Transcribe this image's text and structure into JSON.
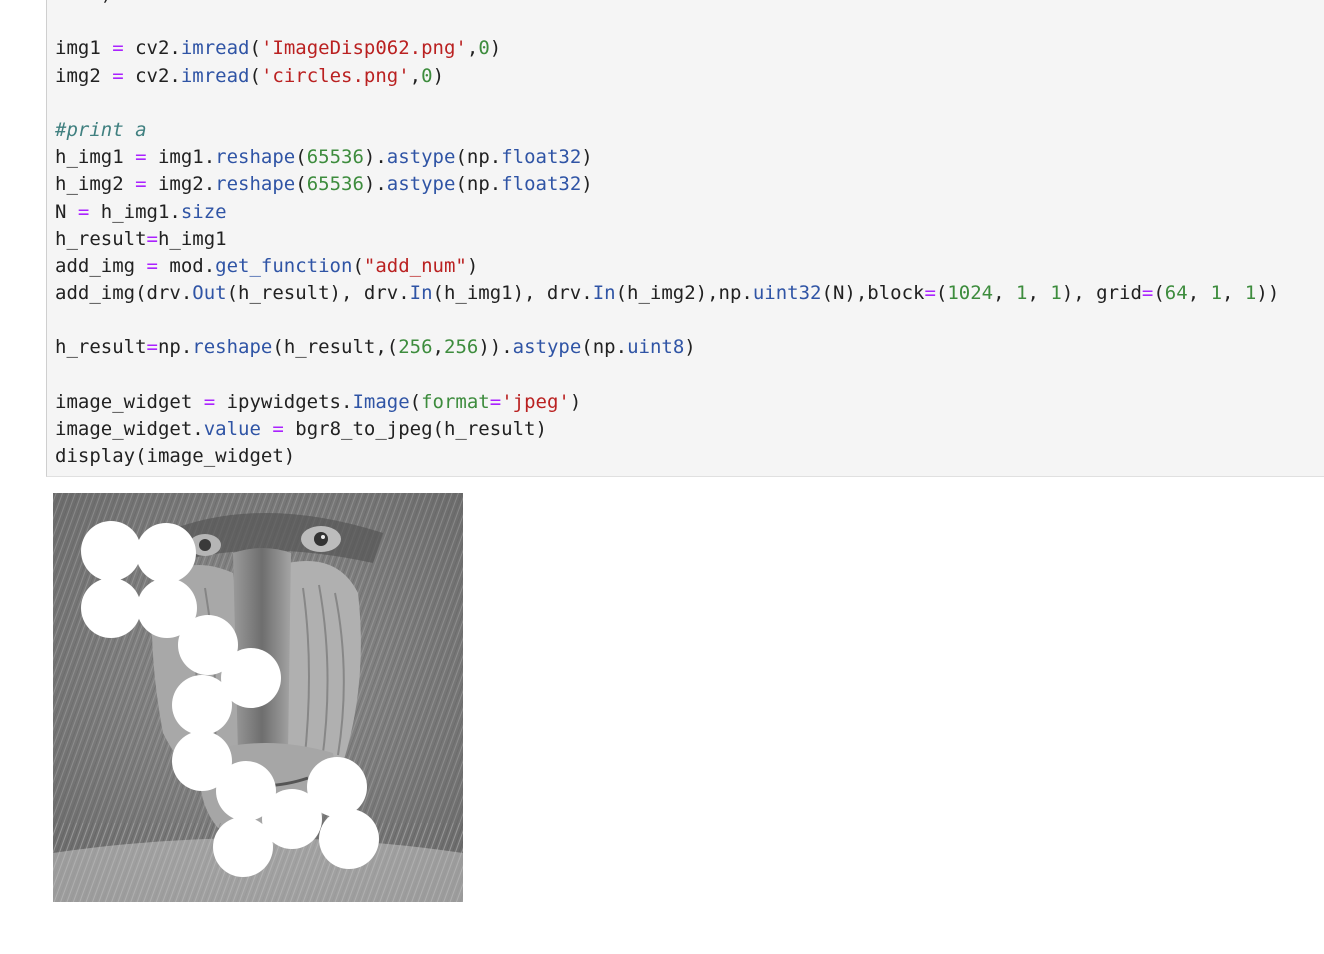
{
  "code_cell": {
    "lines": [
      [
        {
          "t": "    )",
          "c": "plain"
        }
      ],
      [],
      [
        {
          "t": "img1 ",
          "c": "plain"
        },
        {
          "t": "=",
          "c": "op"
        },
        {
          "t": " cv2.",
          "c": "plain"
        },
        {
          "t": "imread",
          "c": "fn"
        },
        {
          "t": "(",
          "c": "plain"
        },
        {
          "t": "'ImageDisp062.png'",
          "c": "str"
        },
        {
          "t": ",",
          "c": "plain"
        },
        {
          "t": "0",
          "c": "num"
        },
        {
          "t": ")",
          "c": "plain"
        }
      ],
      [
        {
          "t": "img2 ",
          "c": "plain"
        },
        {
          "t": "=",
          "c": "op"
        },
        {
          "t": " cv2.",
          "c": "plain"
        },
        {
          "t": "imread",
          "c": "fn"
        },
        {
          "t": "(",
          "c": "plain"
        },
        {
          "t": "'circles.png'",
          "c": "str"
        },
        {
          "t": ",",
          "c": "plain"
        },
        {
          "t": "0",
          "c": "num"
        },
        {
          "t": ")",
          "c": "plain"
        }
      ],
      [],
      [
        {
          "t": "#print a",
          "c": "cm"
        }
      ],
      [
        {
          "t": "h_img1 ",
          "c": "plain"
        },
        {
          "t": "=",
          "c": "op"
        },
        {
          "t": " img1.",
          "c": "plain"
        },
        {
          "t": "reshape",
          "c": "fn"
        },
        {
          "t": "(",
          "c": "plain"
        },
        {
          "t": "65536",
          "c": "num"
        },
        {
          "t": ").",
          "c": "plain"
        },
        {
          "t": "astype",
          "c": "fn"
        },
        {
          "t": "(np.",
          "c": "plain"
        },
        {
          "t": "float32",
          "c": "fn"
        },
        {
          "t": ")",
          "c": "plain"
        }
      ],
      [
        {
          "t": "h_img2 ",
          "c": "plain"
        },
        {
          "t": "=",
          "c": "op"
        },
        {
          "t": " img2.",
          "c": "plain"
        },
        {
          "t": "reshape",
          "c": "fn"
        },
        {
          "t": "(",
          "c": "plain"
        },
        {
          "t": "65536",
          "c": "num"
        },
        {
          "t": ").",
          "c": "plain"
        },
        {
          "t": "astype",
          "c": "fn"
        },
        {
          "t": "(np.",
          "c": "plain"
        },
        {
          "t": "float32",
          "c": "fn"
        },
        {
          "t": ")",
          "c": "plain"
        }
      ],
      [
        {
          "t": "N ",
          "c": "plain"
        },
        {
          "t": "=",
          "c": "op"
        },
        {
          "t": " h_img1.",
          "c": "plain"
        },
        {
          "t": "size",
          "c": "fn"
        }
      ],
      [
        {
          "t": "h_result",
          "c": "plain"
        },
        {
          "t": "=",
          "c": "op"
        },
        {
          "t": "h_img1",
          "c": "plain"
        }
      ],
      [
        {
          "t": "add_img ",
          "c": "plain"
        },
        {
          "t": "=",
          "c": "op"
        },
        {
          "t": " mod.",
          "c": "plain"
        },
        {
          "t": "get_function",
          "c": "fn"
        },
        {
          "t": "(",
          "c": "plain"
        },
        {
          "t": "\"add_num\"",
          "c": "str"
        },
        {
          "t": ")",
          "c": "plain"
        }
      ],
      [
        {
          "t": "add_img(drv.",
          "c": "plain"
        },
        {
          "t": "Out",
          "c": "fn"
        },
        {
          "t": "(h_result), drv.",
          "c": "plain"
        },
        {
          "t": "In",
          "c": "fn"
        },
        {
          "t": "(h_img1), drv.",
          "c": "plain"
        },
        {
          "t": "In",
          "c": "fn"
        },
        {
          "t": "(h_img2),np.",
          "c": "plain"
        },
        {
          "t": "uint32",
          "c": "fn"
        },
        {
          "t": "(N),block",
          "c": "plain"
        },
        {
          "t": "=",
          "c": "op"
        },
        {
          "t": "(",
          "c": "plain"
        },
        {
          "t": "1024",
          "c": "num"
        },
        {
          "t": ", ",
          "c": "plain"
        },
        {
          "t": "1",
          "c": "num"
        },
        {
          "t": ", ",
          "c": "plain"
        },
        {
          "t": "1",
          "c": "num"
        },
        {
          "t": "), grid",
          "c": "plain"
        },
        {
          "t": "=",
          "c": "op"
        },
        {
          "t": "(",
          "c": "plain"
        },
        {
          "t": "64",
          "c": "num"
        },
        {
          "t": ", ",
          "c": "plain"
        },
        {
          "t": "1",
          "c": "num"
        },
        {
          "t": ", ",
          "c": "plain"
        },
        {
          "t": "1",
          "c": "num"
        },
        {
          "t": "))",
          "c": "plain"
        }
      ],
      [],
      [
        {
          "t": "h_result",
          "c": "plain"
        },
        {
          "t": "=",
          "c": "op"
        },
        {
          "t": "np.",
          "c": "plain"
        },
        {
          "t": "reshape",
          "c": "fn"
        },
        {
          "t": "(h_result,(",
          "c": "plain"
        },
        {
          "t": "256",
          "c": "num"
        },
        {
          "t": ",",
          "c": "plain"
        },
        {
          "t": "256",
          "c": "num"
        },
        {
          "t": ")).",
          "c": "plain"
        },
        {
          "t": "astype",
          "c": "fn"
        },
        {
          "t": "(np.",
          "c": "plain"
        },
        {
          "t": "uint8",
          "c": "fn"
        },
        {
          "t": ")",
          "c": "plain"
        }
      ],
      [],
      [
        {
          "t": "image_widget ",
          "c": "plain"
        },
        {
          "t": "=",
          "c": "op"
        },
        {
          "t": " ipywidgets.",
          "c": "plain"
        },
        {
          "t": "Image",
          "c": "fn"
        },
        {
          "t": "(",
          "c": "plain"
        },
        {
          "t": "format",
          "c": "kw"
        },
        {
          "t": "=",
          "c": "op"
        },
        {
          "t": "'jpeg'",
          "c": "str"
        },
        {
          "t": ")",
          "c": "plain"
        }
      ],
      [
        {
          "t": "image_widget.",
          "c": "plain"
        },
        {
          "t": "value",
          "c": "fn"
        },
        {
          "t": " ",
          "c": "plain"
        },
        {
          "t": "=",
          "c": "op"
        },
        {
          "t": " bgr8_to_jpeg(h_result)",
          "c": "plain"
        }
      ],
      [
        {
          "t": "display(image_widget)",
          "c": "plain"
        }
      ]
    ]
  },
  "output": {
    "image_description_icon": "mandrill-with-white-circles-image",
    "background_color": "#7c7c7c",
    "circle_color": "#ffffff"
  }
}
